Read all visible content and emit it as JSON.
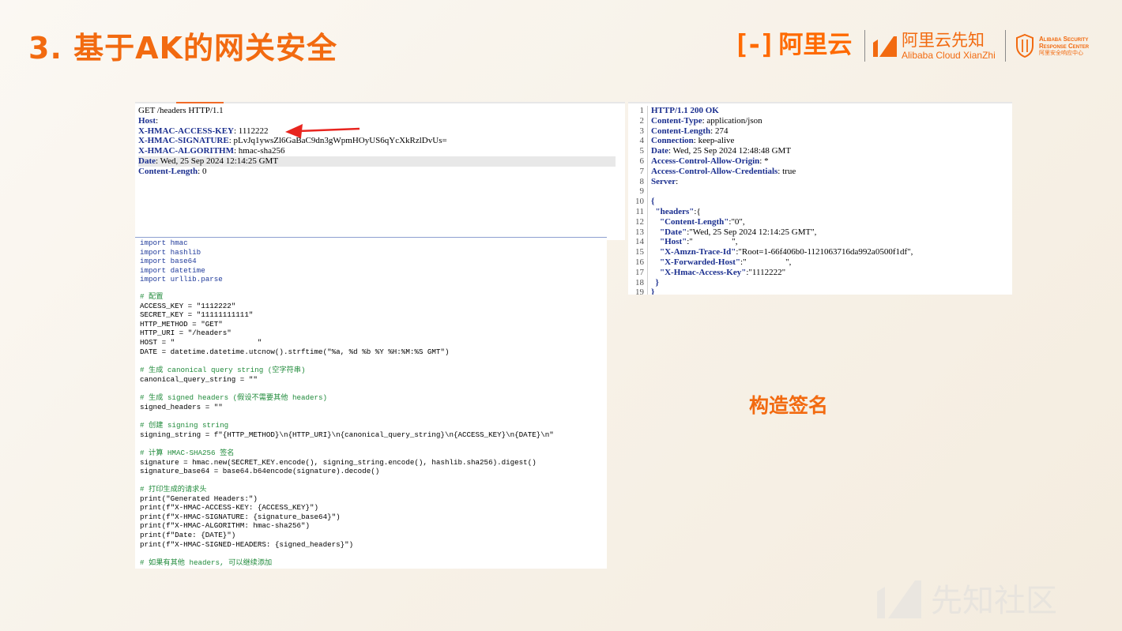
{
  "slide": {
    "title": "3. 基于AK的网关安全",
    "caption": "构造签名"
  },
  "logos": {
    "aliyun": "阿里云",
    "xianzhi_cn": "阿里云先知",
    "xianzhi_en": "Alibaba Cloud XianZhi",
    "asrc_line1": "Alibaba Security",
    "asrc_line2": "Response Center",
    "asrc_line3": "阿里安全响应中心"
  },
  "request": {
    "lines": [
      {
        "key": "GET /headers HTTP/1.1",
        "value": ""
      },
      {
        "key": "Host",
        "value": ":"
      },
      {
        "key": "X-HMAC-ACCESS-KEY",
        "value": ": 1112222"
      },
      {
        "key": "X-HMAC-SIGNATURE",
        "value": ": pLvJq1ywsZl6GaBaC9dn3gWpmHOyUS6qYcXkRzlDvUs="
      },
      {
        "key": "X-HMAC-ALGORITHM",
        "value": ": hmac-sha256"
      },
      {
        "key": "Date",
        "value": ": Wed, 25 Sep 2024 12:14:25 GMT"
      },
      {
        "key": "Content-Length",
        "value": ": 0"
      }
    ]
  },
  "response": {
    "lines": [
      {
        "n": "1",
        "key": "HTTP/1.1 200 OK",
        "value": ""
      },
      {
        "n": "2",
        "key": "Content-Type",
        "value": ": application/json"
      },
      {
        "n": "3",
        "key": "Content-Length",
        "value": ": 274"
      },
      {
        "n": "4",
        "key": "Connection",
        "value": ": keep-alive"
      },
      {
        "n": "5",
        "key": "Date",
        "value": ": Wed, 25 Sep 2024 12:48:48 GMT"
      },
      {
        "n": "6",
        "key": "Access-Control-Allow-Origin",
        "value": ": *"
      },
      {
        "n": "7",
        "key": "Access-Control-Allow-Credentials",
        "value": ": true"
      },
      {
        "n": "8",
        "key": "Server",
        "value": ":"
      },
      {
        "n": "9",
        "key": "",
        "value": ""
      },
      {
        "n": "10",
        "key": "{",
        "value": ""
      },
      {
        "n": "11",
        "key": "  \"headers\"",
        "value": ":{"
      },
      {
        "n": "12",
        "key": "    \"Content-Length\"",
        "value": ":\"0\","
      },
      {
        "n": "13",
        "key": "    \"Date\"",
        "value": ":\"Wed, 25 Sep 2024 12:14:25 GMT\","
      },
      {
        "n": "14",
        "key": "    \"Host\"",
        "value": ":\"                  \","
      },
      {
        "n": "15",
        "key": "    \"X-Amzn-Trace-Id\"",
        "value": ":\"Root=1-66f406b0-1121063716da992a0500f1df\","
      },
      {
        "n": "16",
        "key": "    \"X-Forwarded-Host\"",
        "value": ":\"                  \","
      },
      {
        "n": "17",
        "key": "    \"X-Hmac-Access-Key\"",
        "value": ":\"1112222\""
      },
      {
        "n": "18",
        "key": "  }",
        "value": ""
      },
      {
        "n": "19",
        "key": "}",
        "value": ""
      }
    ]
  },
  "code": {
    "imports": [
      "import hmac",
      "import hashlib",
      "import base64",
      "import datetime",
      "import urllib.parse"
    ],
    "c_config": "# 配置",
    "l_access": "ACCESS_KEY = \"1112222\"",
    "l_secret": "SECRET_KEY = \"11111111111\"",
    "l_method": "HTTP_METHOD = \"GET\"",
    "l_uri": "HTTP_URI = \"/headers\"",
    "l_host": "HOST = \"                   \"",
    "l_date": "DATE = datetime.datetime.utcnow().strftime(\"%a, %d %b %Y %H:%M:%S GMT\")",
    "c_canon": "# 生成 canonical query string (空字符串)",
    "l_canon": "canonical_query_string = \"\"",
    "c_signed": "# 生成 signed headers (假设不需要其他 headers)",
    "l_signed": "signed_headers = \"\"",
    "c_signing": "# 创建 signing string",
    "l_signing": "signing_string = f\"{HTTP_METHOD}\\n{HTTP_URI}\\n{canonical_query_string}\\n{ACCESS_KEY}\\n{DATE}\\n\"",
    "c_hmac": "# 计算 HMAC-SHA256 签名",
    "l_sig": "signature = hmac.new(SECRET_KEY.encode(), signing_string.encode(), hashlib.sha256).digest()",
    "l_sig64": "signature_base64 = base64.b64encode(signature).decode()",
    "c_print": "# 打印生成的请求头",
    "p1": "print(\"Generated Headers:\")",
    "p2": "print(f\"X-HMAC-ACCESS-KEY: {ACCESS_KEY}\")",
    "p3": "print(f\"X-HMAC-SIGNATURE: {signature_base64}\")",
    "p4": "print(f\"X-HMAC-ALGORITHM: hmac-sha256\")",
    "p5": "print(f\"Date: {DATE}\")",
    "p6": "print(f\"X-HMAC-SIGNED-HEADERS: {signed_headers}\")",
    "c_more": "# 如果有其他 headers, 可以继续添加"
  },
  "watermark": {
    "text": "先知社区"
  },
  "colors": {
    "accent": "#f26a10",
    "header_key": "#1b2f8f",
    "arrow": "#e8251f"
  }
}
